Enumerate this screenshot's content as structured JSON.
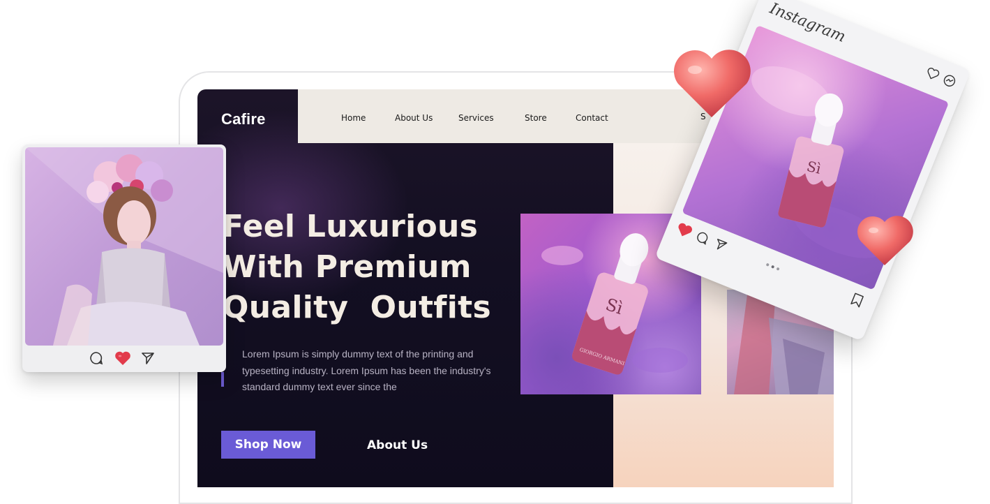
{
  "site": {
    "logo": "Cafire",
    "nav": [
      "Home",
      "About Us",
      "Services",
      "Store",
      "Contact"
    ],
    "nav_peek": "S"
  },
  "hero": {
    "headline_lines": [
      "Feel Luxurious",
      "With Premium",
      "Quality  Outfits"
    ],
    "paragraph_lines": [
      "Lorem Ipsum is simply dummy text of the printing and",
      "typesetting industry. Lorem Ipsum has been the industry's",
      "standard dummy text ever since the"
    ],
    "shop_button": "Shop Now",
    "about_link": "About Us"
  },
  "product": {
    "bottle_text": "Sì",
    "bottle_brand": "GIORGIO ARMANI"
  },
  "instagram_card": {
    "title": "Instagram"
  },
  "colors": {
    "hero_dark": "#130f22",
    "accent": "#6a5bd6",
    "heart": "#e94b5a",
    "headline": "#f4ede4"
  },
  "icons": [
    "comment-icon",
    "heart-icon",
    "send-icon",
    "bookmark-icon",
    "messenger-icon"
  ]
}
